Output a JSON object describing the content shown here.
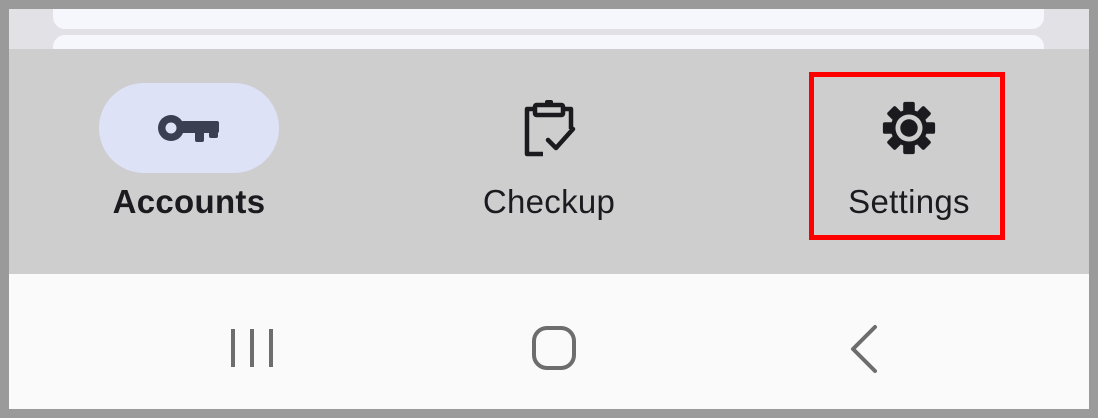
{
  "bottom_nav": {
    "items": [
      {
        "label": "Accounts",
        "icon": "key-icon",
        "selected": true
      },
      {
        "label": "Checkup",
        "icon": "clipboard-check-icon",
        "selected": false
      },
      {
        "label": "Settings",
        "icon": "gear-icon",
        "selected": false
      }
    ]
  },
  "system_nav": {
    "items": [
      {
        "icon": "recents-icon"
      },
      {
        "icon": "home-icon"
      },
      {
        "icon": "back-icon"
      }
    ]
  },
  "colors": {
    "nav_background": "#cececf",
    "selected_pill": "#dee2f7",
    "icon": "#1b1b1f",
    "highlight": "#ff0000"
  }
}
